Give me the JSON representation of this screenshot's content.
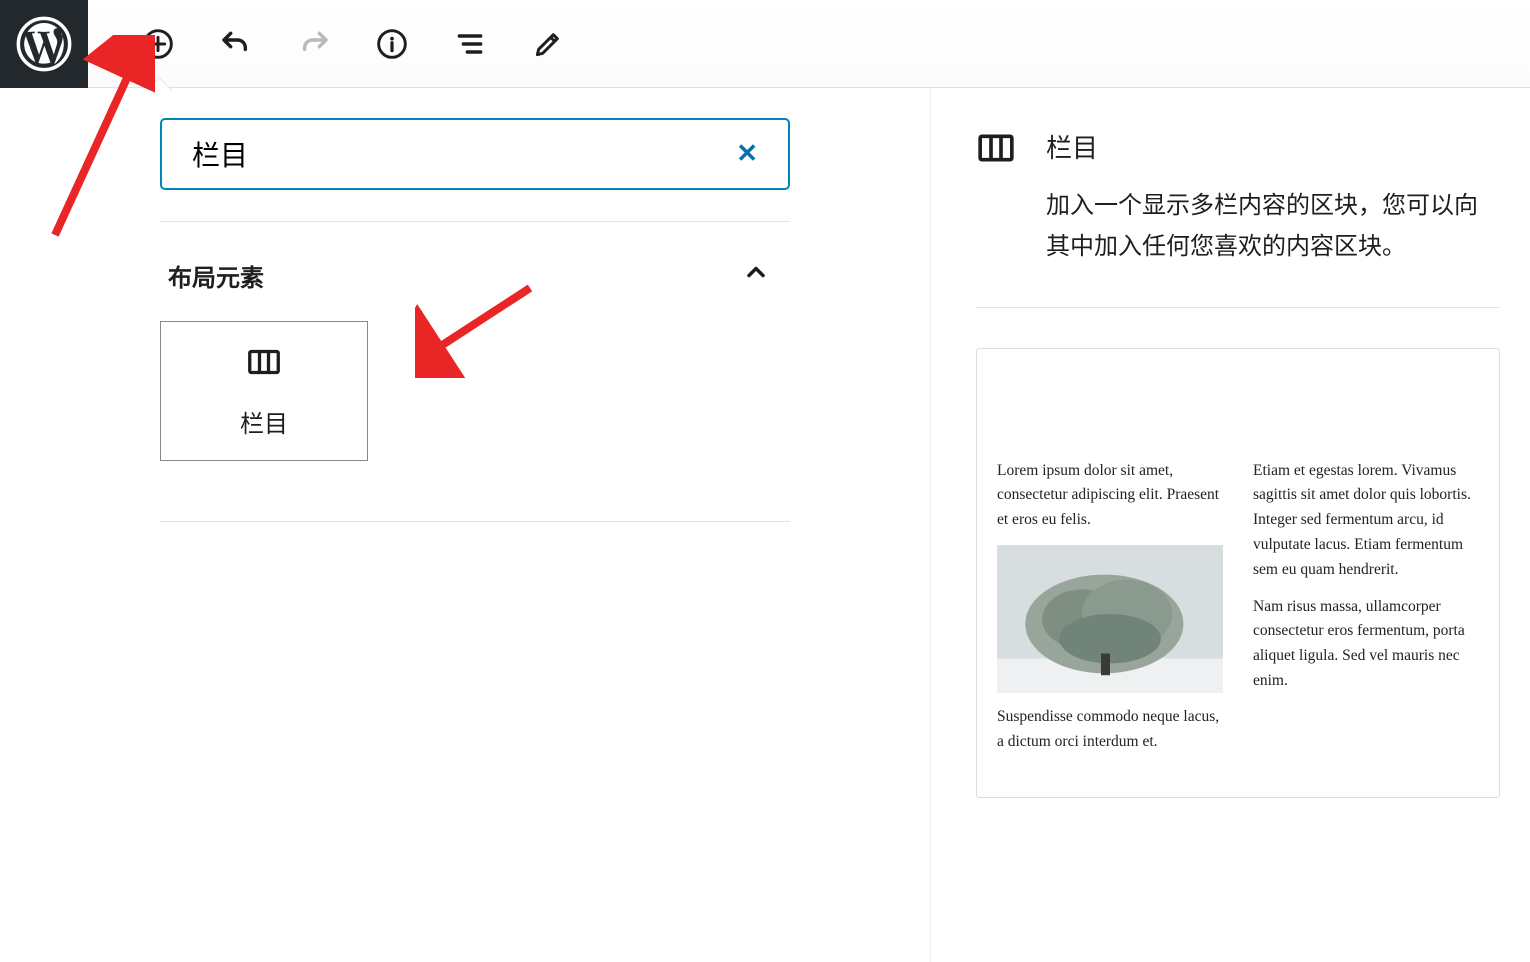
{
  "toolbar": {
    "icons": [
      "add",
      "undo",
      "redo",
      "info",
      "outline",
      "edit"
    ]
  },
  "inserter": {
    "search_value": "栏目",
    "category_title": "布局元素",
    "block_label": "栏目"
  },
  "info_panel": {
    "title": "栏目",
    "description": "加入一个显示多栏内容的区块，您可以向其中加入任何您喜欢的内容区块。"
  },
  "preview": {
    "col1_p1": "Lorem ipsum dolor sit amet, consectetur adipiscing elit. Praesent et eros eu felis.",
    "col1_p2": "Suspendisse commodo neque lacus, a dictum orci interdum et.",
    "col2_p1": "Etiam et egestas lorem. Vivamus sagittis sit amet dolor quis lobortis. Integer sed fermentum arcu, id vulputate lacus. Etiam fermentum sem eu quam hendrerit.",
    "col2_p2": "Nam risus massa, ullamcorper consectetur eros fermentum, porta aliquet ligula. Sed vel mauris nec enim."
  },
  "annotations": {
    "arrow_color": "#ea2525"
  }
}
